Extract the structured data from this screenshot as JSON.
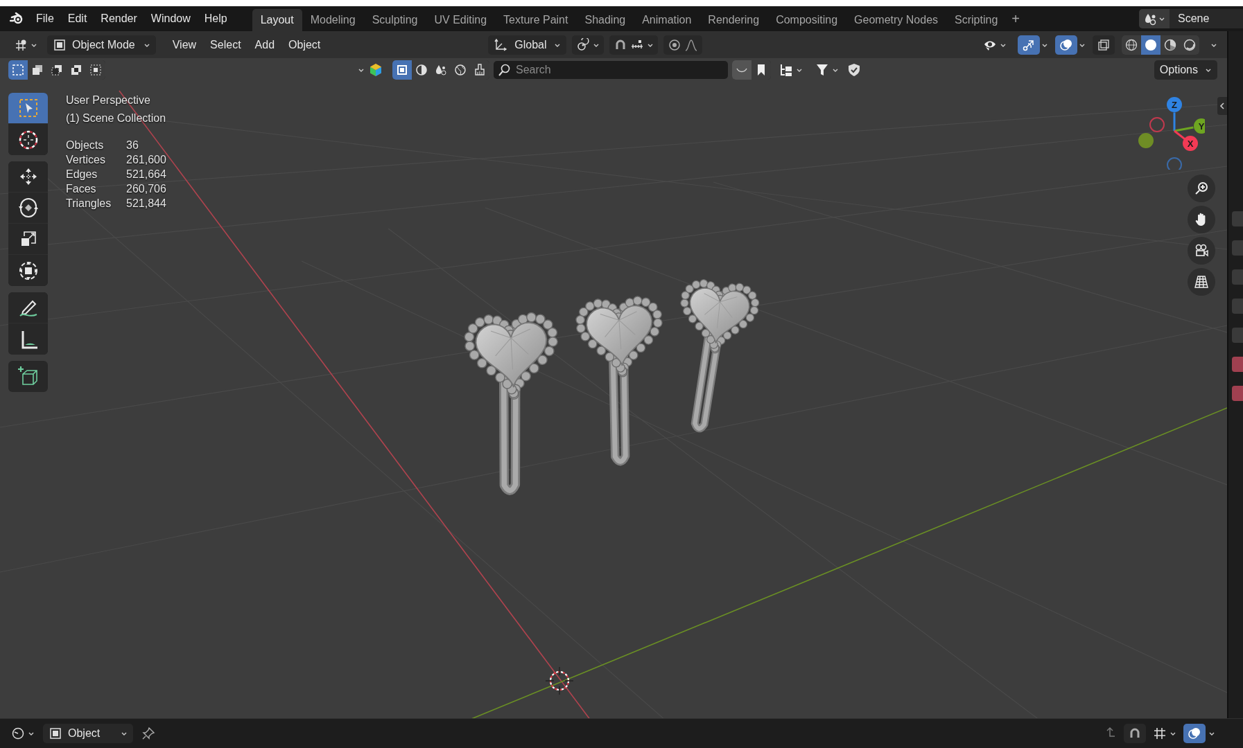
{
  "menu_bar": {
    "menus": [
      "File",
      "Edit",
      "Render",
      "Window",
      "Help"
    ],
    "workspaces": [
      {
        "label": "Layout",
        "selected": true
      },
      {
        "label": "Modeling",
        "selected": false
      },
      {
        "label": "Sculpting",
        "selected": false
      },
      {
        "label": "UV Editing",
        "selected": false
      },
      {
        "label": "Texture Paint",
        "selected": false
      },
      {
        "label": "Shading",
        "selected": false
      },
      {
        "label": "Animation",
        "selected": false
      },
      {
        "label": "Rendering",
        "selected": false
      },
      {
        "label": "Compositing",
        "selected": false
      },
      {
        "label": "Geometry Nodes",
        "selected": false
      },
      {
        "label": "Scripting",
        "selected": false
      }
    ],
    "add_workspace": "+",
    "scene": "Scene"
  },
  "header": {
    "mode": "Object Mode",
    "menus": [
      "View",
      "Select",
      "Add",
      "Object"
    ],
    "orientation": "Global",
    "gizmos_on": true,
    "overlays_on": true,
    "shading": [
      {
        "kind": "wireframe",
        "selected": false
      },
      {
        "kind": "solid",
        "selected": true
      },
      {
        "kind": "material",
        "selected": false
      },
      {
        "kind": "rendered",
        "selected": false
      }
    ]
  },
  "tool_row": {
    "select_modes": [
      {
        "kind": "new",
        "selected": true
      },
      {
        "kind": "extend",
        "selected": false
      },
      {
        "kind": "subtract",
        "selected": false
      },
      {
        "kind": "difference",
        "selected": false
      },
      {
        "kind": "intersect",
        "selected": false
      }
    ],
    "filters": [
      {
        "kind": "select",
        "selected": true
      },
      {
        "kind": "solid",
        "selected": false
      },
      {
        "kind": "particles",
        "selected": false
      },
      {
        "kind": "world",
        "selected": false
      },
      {
        "kind": "paint",
        "selected": false
      }
    ],
    "search": {
      "placeholder": "Search"
    },
    "options": "Options"
  },
  "toolbar": {
    "groups": [
      {
        "tools": [
          {
            "kind": "select_box",
            "selected": true
          },
          {
            "kind": "cursor",
            "selected": false
          }
        ]
      },
      {
        "tools": [
          {
            "kind": "move",
            "selected": false
          },
          {
            "kind": "rotate",
            "selected": false
          },
          {
            "kind": "scale",
            "selected": false
          },
          {
            "kind": "transform",
            "selected": false
          }
        ]
      },
      {
        "tools": [
          {
            "kind": "annotate",
            "selected": false
          },
          {
            "kind": "measure",
            "selected": false
          }
        ]
      },
      {
        "tools": [
          {
            "kind": "add_cube",
            "selected": false
          }
        ]
      }
    ]
  },
  "viewport": {
    "view_name": "User Perspective",
    "collection": "(1) Scene Collection",
    "stats": [
      {
        "label": "Objects",
        "value": "36"
      },
      {
        "label": "Vertices",
        "value": "261,600"
      },
      {
        "label": "Edges",
        "value": "521,664"
      },
      {
        "label": "Faces",
        "value": "260,706"
      },
      {
        "label": "Triangles",
        "value": "521,844"
      }
    ],
    "gizmo": {
      "axes": [
        {
          "label": "Z",
          "color": "#2f83e3"
        },
        {
          "label": "Y",
          "color": "#6ea521"
        },
        {
          "label": "X",
          "color": "#f33a55"
        }
      ],
      "negative_axes": [
        {
          "color": "#c0394e"
        },
        {
          "color": "#6f8d25"
        },
        {
          "color": "#3a6aa8"
        }
      ]
    }
  },
  "status_bar": {
    "mode": "Object"
  }
}
